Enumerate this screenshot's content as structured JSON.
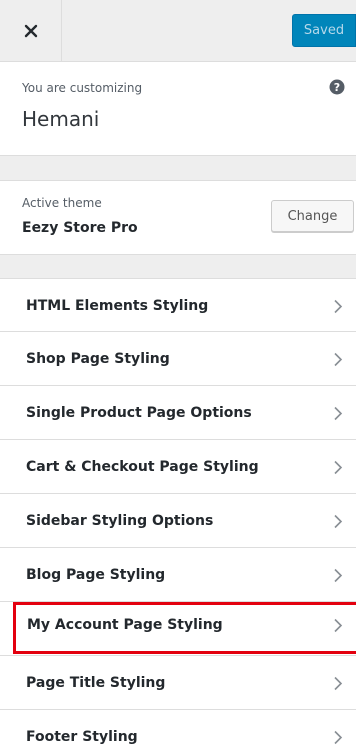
{
  "header": {
    "close_icon": "close-icon",
    "saved_label": "Saved"
  },
  "info": {
    "customizing_label": "You are customizing",
    "site_name": "Hemani",
    "help_icon": "help-icon"
  },
  "theme": {
    "label": "Active theme",
    "name": "Eezy Store Pro",
    "change_label": "Change"
  },
  "menu": {
    "items": [
      {
        "label": "HTML Elements Styling"
      },
      {
        "label": "Shop Page Styling"
      },
      {
        "label": "Single Product Page Options"
      },
      {
        "label": "Cart & Checkout Page Styling"
      },
      {
        "label": "Sidebar Styling Options"
      },
      {
        "label": "Blog Page Styling"
      },
      {
        "label": "My Account Page Styling"
      },
      {
        "label": "Page Title Styling"
      },
      {
        "label": "Footer Styling"
      }
    ],
    "highlighted_index": 6,
    "highlight_color": "#e3000f"
  },
  "colors": {
    "accent": "#0085ba",
    "background": "#eeeeee"
  }
}
